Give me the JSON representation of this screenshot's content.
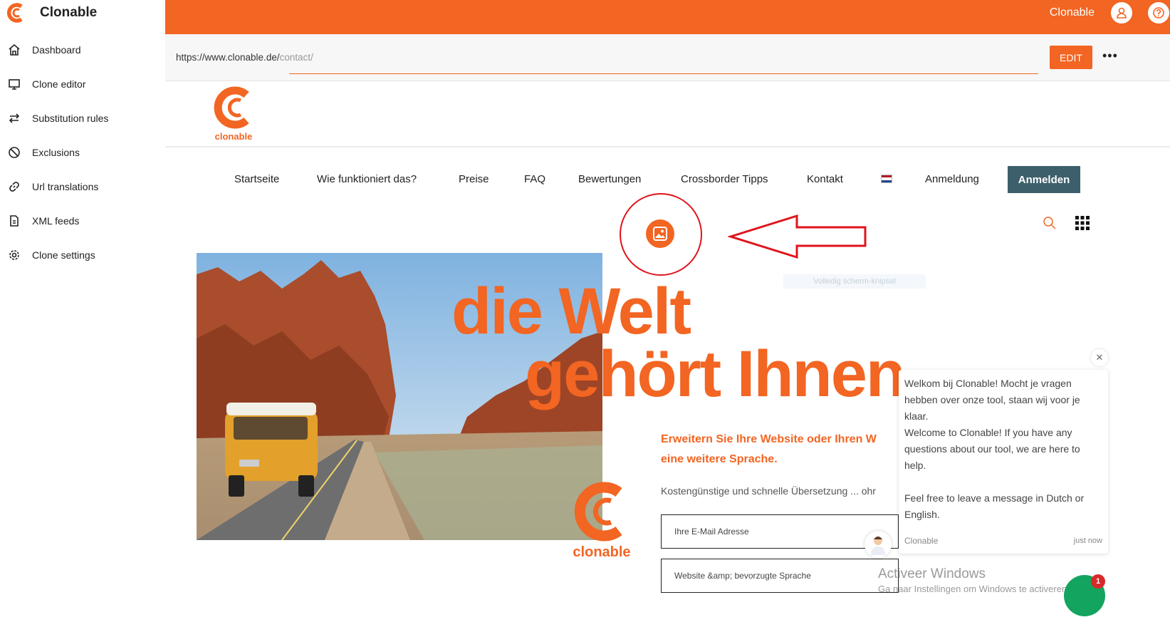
{
  "app": {
    "title": "Clonable"
  },
  "colors": {
    "accent": "#f26522",
    "nav_button": "#3d5f6b",
    "annotation": "#e0131b",
    "chat_launcher": "#13a45f"
  },
  "sidebar": {
    "items": [
      {
        "label": "Dashboard",
        "icon": "home-icon"
      },
      {
        "label": "Clone editor",
        "icon": "monitor-icon"
      },
      {
        "label": "Substitution rules",
        "icon": "swap-icon"
      },
      {
        "label": "Exclusions",
        "icon": "ban-icon"
      },
      {
        "label": "Url translations",
        "icon": "link-icon"
      },
      {
        "label": "XML feeds",
        "icon": "file-icon"
      },
      {
        "label": "Clone settings",
        "icon": "gear-icon"
      }
    ]
  },
  "topbar": {
    "user_name": "Clonable"
  },
  "urlbar": {
    "base": "https://www.clonable.de/",
    "path": "contact/",
    "edit_label": "EDIT",
    "more_label": "•••"
  },
  "site": {
    "logo_text": "clonable",
    "nav": [
      "Startseite",
      "Wie funktioniert das?",
      "Preise",
      "FAQ",
      "Bewertungen",
      "Crossborder Tipps",
      "Kontakt",
      "Anmeldung"
    ],
    "nav_button": "Anmelden",
    "hero_line1": "die Welt",
    "hero_line2": "gehört Ihnen",
    "subtitle_line1": "Erweitern Sie Ihre Website oder Ihren W",
    "subtitle_line2": "eine weitere Sprache.",
    "tagline": "Kostengünstige und schnelle Übersetzung ... ohr",
    "email_placeholder": "Ihre E-Mail Adresse",
    "website_placeholder": "Website &amp; bevorzugte Sprache",
    "hero_logo_text": "clonable"
  },
  "overlay": {
    "snip_label": "Volledig scherm-knipsel"
  },
  "chat": {
    "close": "✕",
    "msg1": "Welkom bij Clonable! Mocht je vragen hebben over onze tool, staan wij voor je klaar.",
    "msg2": "Welcome to Clonable! If you have any questions about our tool, we are here to help.",
    "msg3": "Feel free to leave a message in Dutch or English.",
    "sender": "Clonable",
    "time": "just now",
    "badge": "1"
  },
  "windows": {
    "line1": "Activeer Windows",
    "line2": "Ga naar Instellingen om Windows te activeren."
  }
}
